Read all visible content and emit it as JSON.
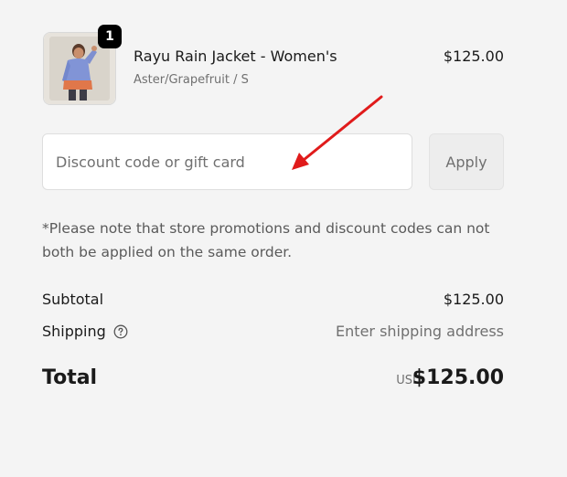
{
  "product": {
    "name": "Rayu Rain Jacket - Women's",
    "variant": "Aster/Grapefruit / S",
    "price": "$125.00",
    "quantity": "1",
    "image_icon": "product-photo-jacket"
  },
  "discount": {
    "placeholder": "Discount code or gift card",
    "value": "",
    "apply_label": "Apply"
  },
  "note": "*Please note that store promotions and discount codes can not both be applied on the same order.",
  "summary": {
    "subtotal_label": "Subtotal",
    "subtotal_value": "$125.00",
    "shipping_label": "Shipping",
    "shipping_help_icon": "question-circle-icon",
    "shipping_value": "Enter shipping address",
    "total_label": "Total",
    "total_currency": "USD",
    "total_value": "$125.00"
  },
  "colors": {
    "background": "#f4f4f4",
    "annotation_arrow": "#e01b1b",
    "badge": "#000000"
  }
}
